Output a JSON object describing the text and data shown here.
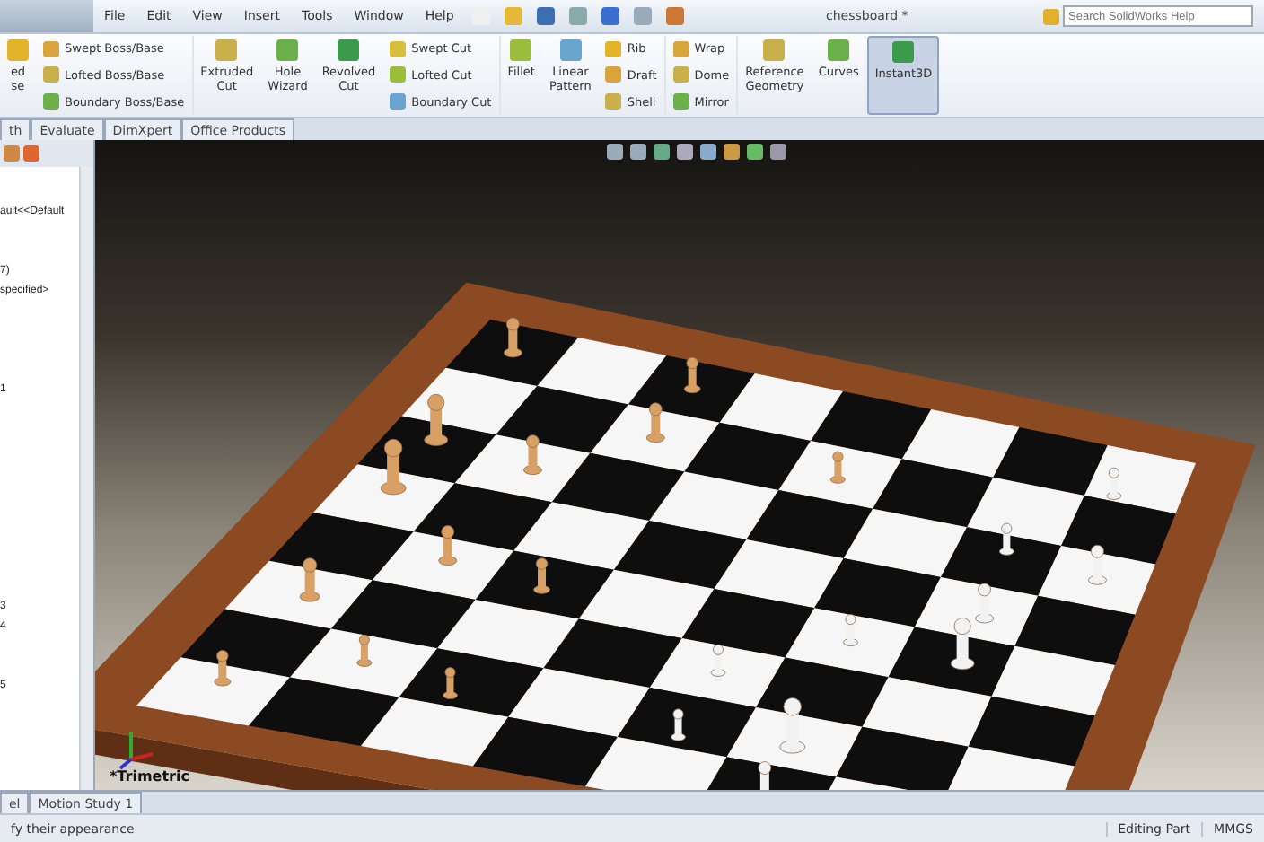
{
  "menu": [
    "File",
    "Edit",
    "View",
    "Insert",
    "Tools",
    "Window",
    "Help"
  ],
  "window": {
    "title": "chessboard *"
  },
  "search": {
    "placeholder": "Search SolidWorks Help"
  },
  "ribbon": [
    {
      "kind": "large",
      "lines": [
        "ed",
        "se"
      ],
      "selected": false
    },
    {
      "kind": "column",
      "items": [
        "Swept Boss/Base",
        "Lofted Boss/Base",
        "Boundary Boss/Base"
      ]
    },
    {
      "kind": "large",
      "lines": [
        "Extruded",
        "Cut"
      ],
      "selected": false
    },
    {
      "kind": "large",
      "lines": [
        "Hole",
        "Wizard"
      ],
      "selected": false
    },
    {
      "kind": "large",
      "lines": [
        "Revolved",
        "Cut"
      ],
      "selected": false
    },
    {
      "kind": "column",
      "items": [
        "Swept Cut",
        "Lofted Cut",
        "Boundary Cut"
      ]
    },
    {
      "kind": "large",
      "lines": [
        "Fillet"
      ],
      "selected": false
    },
    {
      "kind": "large",
      "lines": [
        "Linear",
        "Pattern"
      ],
      "selected": false
    },
    {
      "kind": "column",
      "items": [
        "Rib",
        "Draft",
        "Shell"
      ]
    },
    {
      "kind": "column",
      "items": [
        "Wrap",
        "Dome",
        "Mirror"
      ]
    },
    {
      "kind": "large",
      "lines": [
        "Reference",
        "Geometry"
      ],
      "selected": false
    },
    {
      "kind": "large",
      "lines": [
        "Curves"
      ],
      "selected": false
    },
    {
      "kind": "large",
      "lines": [
        "Instant3D"
      ],
      "selected": true
    }
  ],
  "tabs": [
    {
      "label": "th",
      "selected": false
    },
    {
      "label": "Evaluate",
      "selected": false
    },
    {
      "label": "DimXpert",
      "selected": false
    },
    {
      "label": "Office Products",
      "selected": false
    }
  ],
  "tree": {
    "lines": [
      "ault<<Default",
      "7)",
      "specified>",
      "1",
      "3",
      "4",
      "5"
    ]
  },
  "viewport": {
    "view_label": "*Trimetric"
  },
  "bottom_tabs": [
    {
      "label": "el",
      "selected": false
    },
    {
      "label": "Motion Study 1",
      "selected": false
    }
  ],
  "status_bar": {
    "message": "fy their appearance",
    "mode": "Editing Part",
    "units": "MMGS"
  }
}
